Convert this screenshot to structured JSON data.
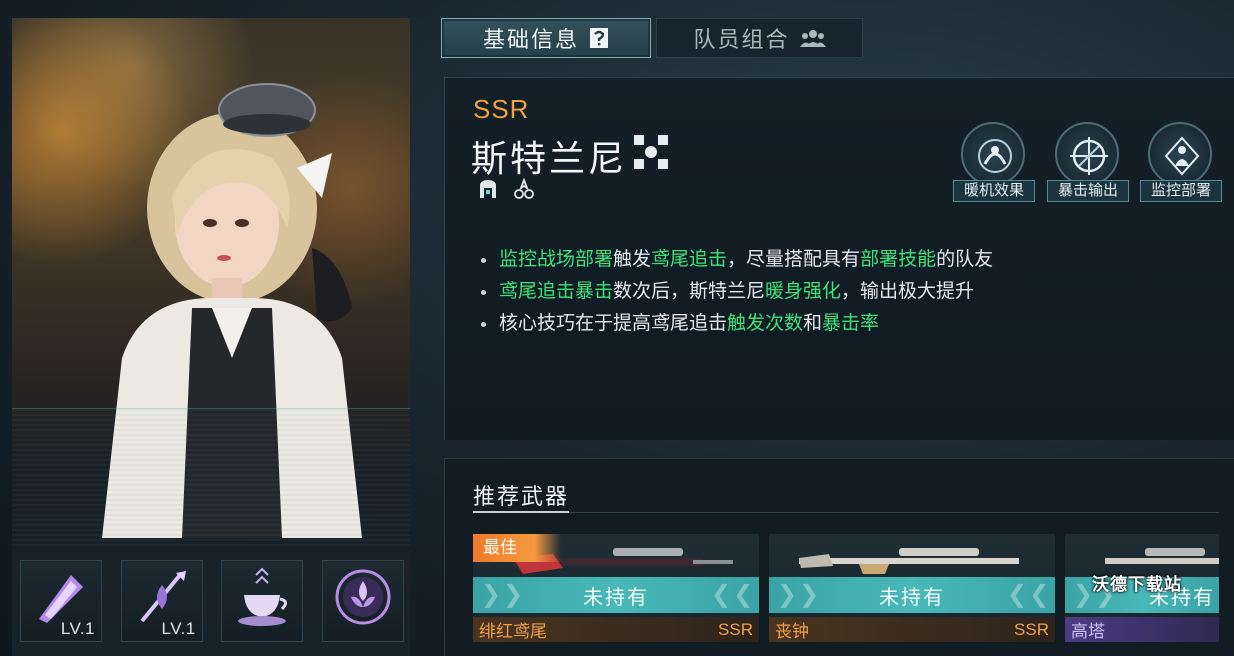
{
  "tabs": {
    "basic": "基础信息",
    "team": "队员组合"
  },
  "character": {
    "rarity": "SSR",
    "name": "斯特兰尼"
  },
  "traits": [
    {
      "label": "暖机效果",
      "icon": "warmup-icon"
    },
    {
      "label": "暴击输出",
      "icon": "crosshair-icon"
    },
    {
      "label": "监控部署",
      "icon": "monitor-deploy-icon"
    }
  ],
  "tips": [
    [
      {
        "t": "监控战场部署",
        "hl": true
      },
      {
        "t": "触发",
        "hl": false
      },
      {
        "t": "鸢尾追击",
        "hl": true
      },
      {
        "t": "，尽量搭配具有",
        "hl": false
      },
      {
        "t": "部署技能",
        "hl": true
      },
      {
        "t": "的队友",
        "hl": false
      }
    ],
    [
      {
        "t": "鸢尾追击暴击",
        "hl": true
      },
      {
        "t": "数次后，斯特兰尼",
        "hl": false
      },
      {
        "t": "暖身强化",
        "hl": true
      },
      {
        "t": "，输出极大提升",
        "hl": false
      }
    ],
    [
      {
        "t": "核心技巧在于提高鸢尾追击",
        "hl": false
      },
      {
        "t": "触发次数",
        "hl": true
      },
      {
        "t": "和",
        "hl": false
      },
      {
        "t": "暴击率",
        "hl": true
      }
    ]
  ],
  "skills": [
    {
      "name": "skill-1",
      "level": "LV.1"
    },
    {
      "name": "skill-2",
      "level": "LV.1"
    },
    {
      "name": "skill-3",
      "level": ""
    },
    {
      "name": "skill-4",
      "level": ""
    }
  ],
  "weapons": {
    "title": "推荐武器",
    "items": [
      {
        "name": "绯红鸢尾",
        "rarity": "SSR",
        "status": "未持有",
        "tag": "最佳"
      },
      {
        "name": "丧钟",
        "rarity": "SSR",
        "status": "未持有",
        "tag": ""
      },
      {
        "name": "高塔",
        "rarity": "",
        "status": "未持有",
        "tag": ""
      }
    ]
  },
  "watermark": "沃德下载站",
  "colors": {
    "accent_green": "#3fe27a",
    "rarity_orange": "#f0a03c",
    "status_teal": "#48b8b8",
    "best_orange": "#f07a2a",
    "purple_tier": "#4c3c86"
  }
}
